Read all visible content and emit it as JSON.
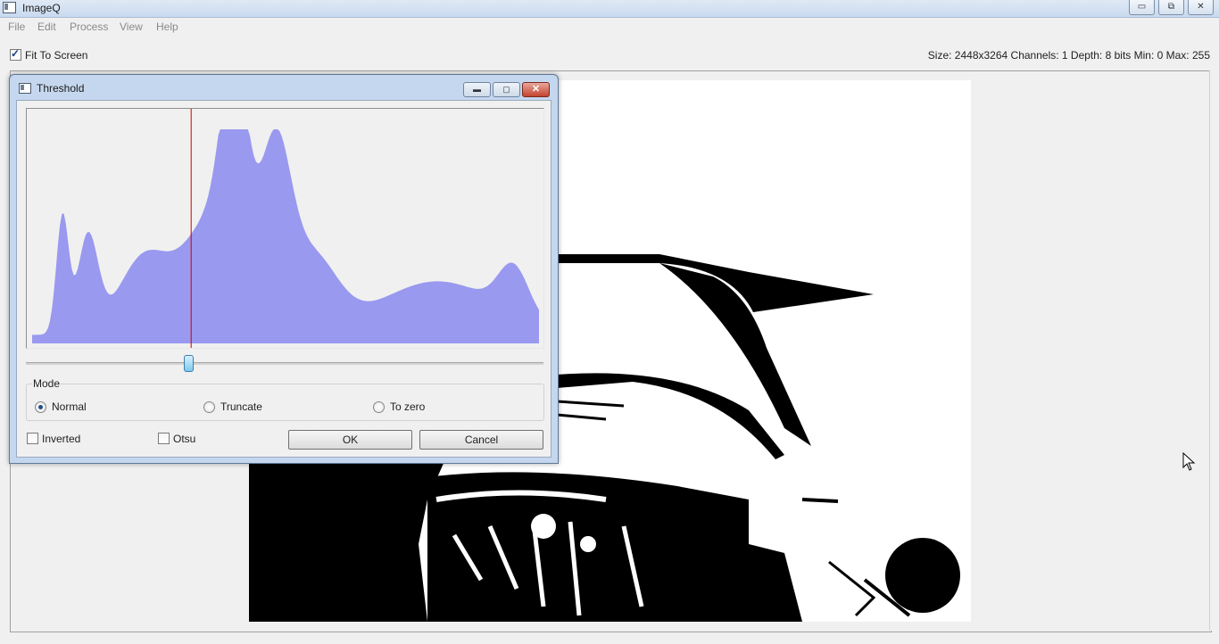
{
  "window": {
    "title": "ImageQ",
    "buttons": {
      "minimize": "▭",
      "restore": "⧉",
      "close": "✕"
    }
  },
  "menu": [
    "File",
    "Edit",
    "Process",
    "View",
    "Help"
  ],
  "toolbar": {
    "fit_to_screen": "Fit To Screen",
    "fit_checked": true
  },
  "info": {
    "text": "Size:  2448x3264  Channels:  1  Depth:  8 bits  Min:  0  Max:  255"
  },
  "dialog": {
    "title": "Threshold",
    "buttons": {
      "minimize": "▬",
      "maximize": "▢",
      "close": "✕"
    },
    "histogram": {
      "bar_color": "#9999f0",
      "marker_color": "#cc0000",
      "threshold_value": 80,
      "slider_max": 255
    },
    "mode": {
      "title": "Mode",
      "options": [
        {
          "label": "Normal",
          "checked": true
        },
        {
          "label": "Truncate",
          "checked": false
        },
        {
          "label": "To zero",
          "checked": false
        }
      ]
    },
    "inverted": {
      "label": "Inverted",
      "checked": false
    },
    "otsu": {
      "label": "Otsu",
      "checked": false
    },
    "ok": "OK",
    "cancel": "Cancel"
  }
}
